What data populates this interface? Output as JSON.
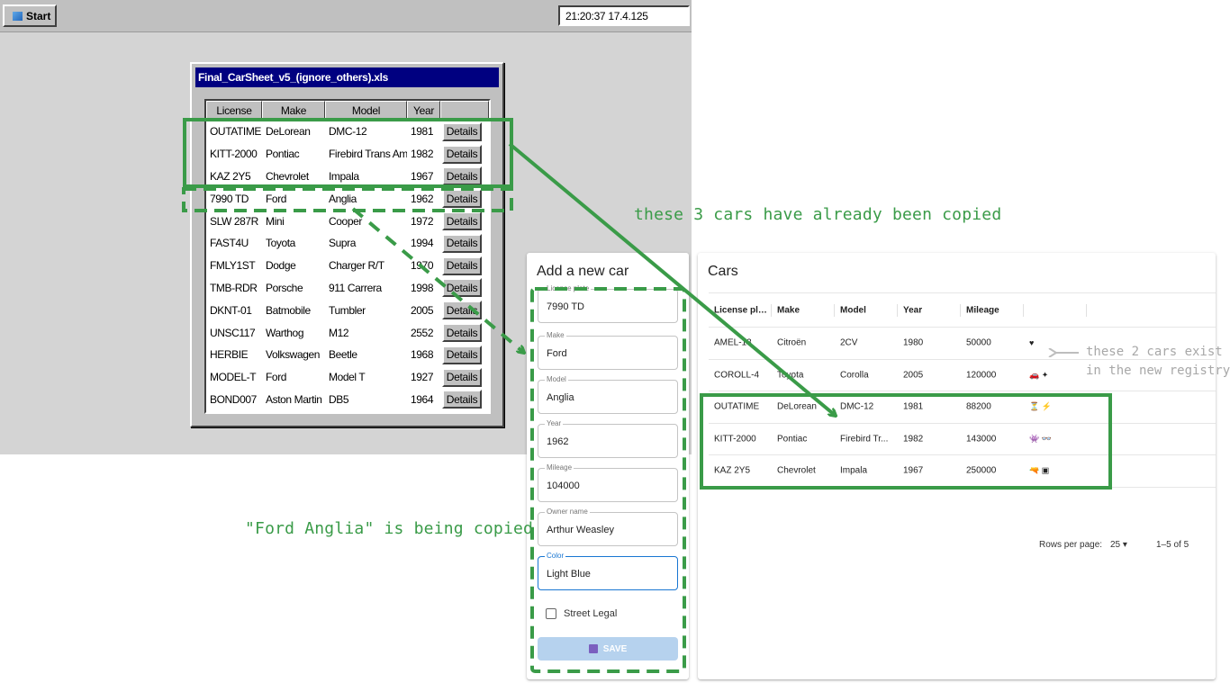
{
  "taskbar": {
    "start_label": "Start",
    "clock": "21:20:37  17.4.125"
  },
  "spreadsheet": {
    "title": "Final_CarSheet_v5_(ignore_others).xls",
    "columns": [
      "License",
      "Make",
      "Model",
      "Year"
    ],
    "details_label": "Details",
    "rows": [
      {
        "license": "OUTATIME",
        "make": "DeLorean",
        "model": "DMC-12",
        "year": "1981"
      },
      {
        "license": "KITT-2000",
        "make": "Pontiac",
        "model": "Firebird Trans Am",
        "year": "1982"
      },
      {
        "license": "KAZ 2Y5",
        "make": "Chevrolet",
        "model": "Impala",
        "year": "1967"
      },
      {
        "license": "7990 TD",
        "make": "Ford",
        "model": "Anglia",
        "year": "1962"
      },
      {
        "license": "SLW 287R",
        "make": "Mini",
        "model": "Cooper",
        "year": "1972"
      },
      {
        "license": "FAST4U",
        "make": "Toyota",
        "model": "Supra",
        "year": "1994"
      },
      {
        "license": "FMLY1ST",
        "make": "Dodge",
        "model": "Charger R/T",
        "year": "1970"
      },
      {
        "license": "TMB-RDR",
        "make": "Porsche",
        "model": "911 Carrera",
        "year": "1998"
      },
      {
        "license": "DKNT-01",
        "make": "Batmobile",
        "model": "Tumbler",
        "year": "2005"
      },
      {
        "license": "UNSC117",
        "make": "Warthog",
        "model": "M12",
        "year": "2552"
      },
      {
        "license": "HERBIE",
        "make": "Volkswagen",
        "model": "Beetle",
        "year": "1968"
      },
      {
        "license": "MODEL-T",
        "make": "Ford",
        "model": "Model T",
        "year": "1927"
      },
      {
        "license": "BOND007",
        "make": "Aston Martin",
        "model": "DB5",
        "year": "1964"
      }
    ]
  },
  "form": {
    "title": "Add a new car",
    "fields": [
      {
        "label": "License plate",
        "value": "7990 TD"
      },
      {
        "label": "Make",
        "value": "Ford"
      },
      {
        "label": "Model",
        "value": "Anglia"
      },
      {
        "label": "Year",
        "value": "1962"
      },
      {
        "label": "Mileage",
        "value": "104000"
      },
      {
        "label": "Owner name",
        "value": "Arthur Weasley"
      },
      {
        "label": "Color",
        "value": "Light Blue"
      }
    ],
    "street_legal_label": "Street Legal",
    "save_label": "SAVE"
  },
  "cars": {
    "title": "Cars",
    "columns": [
      "License pla...",
      "Make",
      "Model",
      "Year",
      "Mileage"
    ],
    "rows": [
      {
        "license": "AMEL-13",
        "make": "Citroën",
        "model": "2CV",
        "year": "1980",
        "mileage": "50000",
        "icons": "♥"
      },
      {
        "license": "COROLL-4",
        "make": "Toyota",
        "model": "Corolla",
        "year": "2005",
        "mileage": "120000",
        "icons": "🚗 ✦"
      },
      {
        "license": "OUTATIME",
        "make": "DeLorean",
        "model": "DMC-12",
        "year": "1981",
        "mileage": "88200",
        "icons": "⏳ ⚡"
      },
      {
        "license": "KITT-2000",
        "make": "Pontiac",
        "model": "Firebird Tr...",
        "year": "1982",
        "mileage": "143000",
        "icons": "👾 👓"
      },
      {
        "license": "KAZ 2Y5",
        "make": "Chevrolet",
        "model": "Impala",
        "year": "1967",
        "mileage": "250000",
        "icons": "🔫 ▣"
      }
    ],
    "rows_per_page_label": "Rows per page:",
    "rows_per_page_value": "25 ▾",
    "range_label": "1–5 of 5"
  },
  "annotations": {
    "copied": "these 3 cars have already been copied",
    "anglia": "\"Ford Anglia\" is being copied",
    "exist_line1": "these 2 cars exist",
    "exist_line2": "in the new registry"
  },
  "colors": {
    "annotation_green": "#3a9b48",
    "annotation_gray": "#a8a8a8",
    "title_bar": "#000080",
    "focus_blue": "#1976d2"
  }
}
